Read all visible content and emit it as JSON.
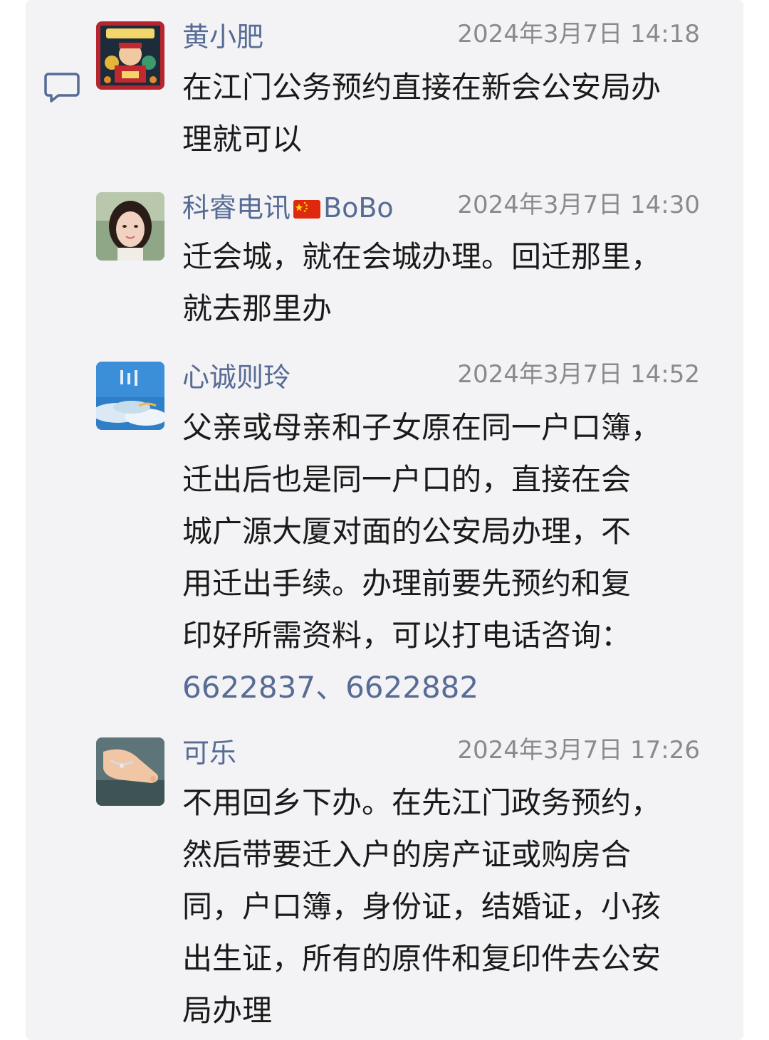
{
  "comments": [
    {
      "name": "黄小肥",
      "time": "2024年3月7日 14:18",
      "avatar_icon": "red-festive-avatar",
      "lines": [
        "在江门公务预约直接在新会公安局办",
        "理就可以"
      ]
    },
    {
      "name_prefix": "科睿电讯",
      "name_flag": "china-flag-icon",
      "name_suffix": "BoBo",
      "time": "2024年3月7日 14:30",
      "avatar_icon": "woman-portrait-avatar",
      "lines": [
        "迁会城，就在会城办理。回迁那里，",
        "就去那里办"
      ]
    },
    {
      "name": "心诚则玲",
      "time": "2024年3月7日 14:52",
      "avatar_icon": "blue-sky-avatar",
      "lines": [
        "父亲或母亲和子女原在同一户口簿，",
        "迁出后也是同一户口的，直接在会",
        "城广源大厦对面的公安局办理，不",
        "用迁出手续。办理前要先预约和复",
        "印好所需资料，可以打电话咨询："
      ],
      "phone_1": "6622837",
      "phone_sep": "、",
      "phone_2": "6622882"
    },
    {
      "name": "可乐",
      "time": "2024年3月7日 17:26",
      "avatar_icon": "anklet-foot-avatar",
      "lines": [
        "不用回乡下办。在先江门政务预约，",
        "然后带要迁入户的房产证或购房合",
        "同，户口簿，身份证，结婚证，小孩",
        "出生证，所有的原件和复印件去公安",
        "局办理"
      ]
    }
  ],
  "icons": {
    "comment_icon": "comment-bubble-icon"
  },
  "colors": {
    "name": "#576b95",
    "time": "#8a8a8a",
    "text": "#1a1a1a",
    "panel": "#f3f3f5"
  }
}
